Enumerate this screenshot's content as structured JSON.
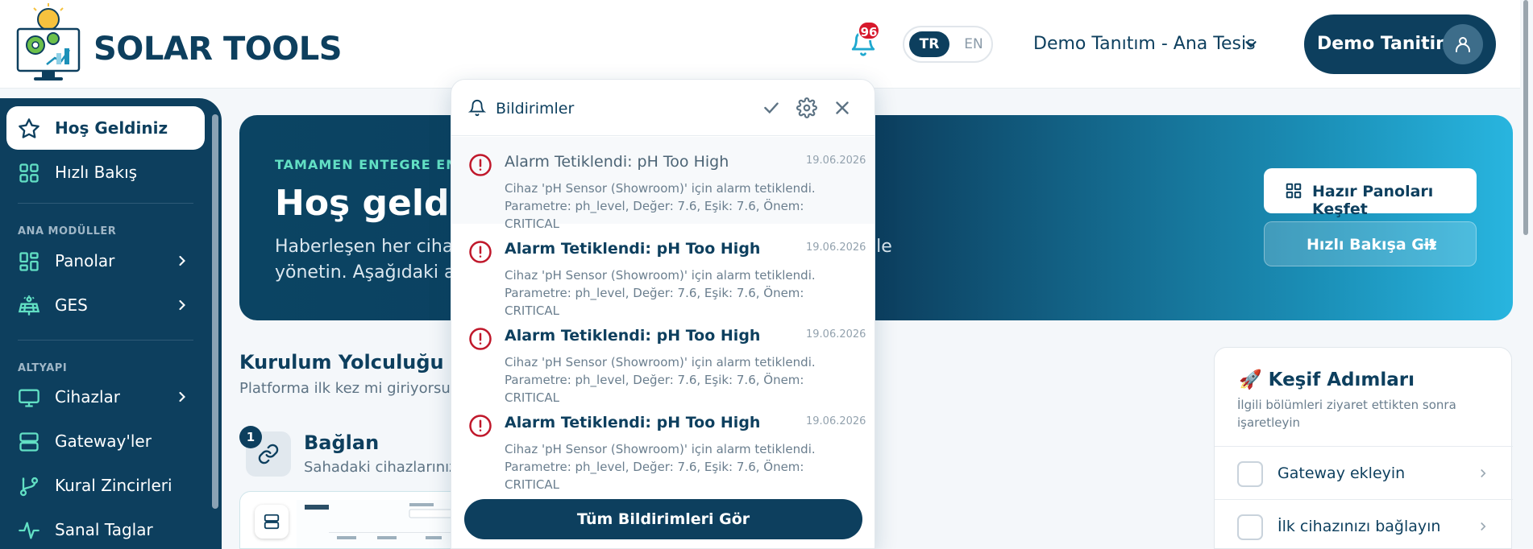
{
  "header": {
    "logo_text": "SOLAR TOOLS",
    "notification_count": "96",
    "lang_tr": "TR",
    "lang_en": "EN",
    "facility": "Demo Tanıtım - Ana Tesis",
    "user_name": "Demo Tanitim"
  },
  "sidebar": {
    "items_top": [
      {
        "label": "Hoş Geldiniz",
        "icon": "star-icon",
        "active": true
      },
      {
        "label": "Hızlı Bakış",
        "icon": "grid-icon"
      }
    ],
    "section_main": "ANA MODÜLLER",
    "items_main": [
      {
        "label": "Panolar",
        "icon": "dashboard-icon"
      },
      {
        "label": "GES",
        "icon": "solar-panel-icon"
      }
    ],
    "section_infra": "ALTYAPI",
    "items_infra": [
      {
        "label": "Cihazlar",
        "icon": "monitor-icon"
      },
      {
        "label": "Gateway'ler",
        "icon": "server-icon"
      },
      {
        "label": "Kural Zincirleri",
        "icon": "git-branch-icon"
      },
      {
        "label": "Sanal Taglar",
        "icon": "activity-icon"
      }
    ]
  },
  "hero": {
    "kicker": "TAMAMEN ENTEGRE ENE",
    "title": "Hoş geldiniz",
    "desc_line1_start": "Haberleşen her cihazı t",
    "desc_line1_end": "pay zekâ ile",
    "desc_line2": "yönetin. Aşağıdaki adım",
    "btn_explore": "Hazır Panoları Keşfet",
    "btn_quick": "Hızlı Bakışa Git"
  },
  "journey": {
    "title": "Kurulum Yolculuğu",
    "subtitle": "Platforma ilk kez mi giriyorsunuz",
    "step_number": "1",
    "step_title": "Bağlan",
    "step_desc": "Sahadaki cihazlarınızı"
  },
  "explore": {
    "title": "Keşif Adımları",
    "subtitle": "İlgili bölümleri ziyaret ettikten sonra işaretleyin",
    "items": [
      {
        "label": "Gateway ekleyin"
      },
      {
        "label": "İlk cihazınızı bağlayın"
      }
    ]
  },
  "notifications": {
    "title": "Bildirimler",
    "items": [
      {
        "title": "Alarm Tetiklendi: pH Too High",
        "date": "19.06.2026",
        "line1": "Cihaz 'pH Sensor (Showroom)' için alarm tetiklendi.",
        "line2": "Parametre: ph_level, Değer: 7.6, Eşik: 7.6, Önem: CRITICAL",
        "read": true
      },
      {
        "title": "Alarm Tetiklendi: pH Too High",
        "date": "19.06.2026",
        "line1": "Cihaz 'pH Sensor (Showroom)' için alarm tetiklendi.",
        "line2": "Parametre: ph_level, Değer: 7.6, Eşik: 7.6, Önem: CRITICAL",
        "read": false
      },
      {
        "title": "Alarm Tetiklendi: pH Too High",
        "date": "19.06.2026",
        "line1": "Cihaz 'pH Sensor (Showroom)' için alarm tetiklendi.",
        "line2": "Parametre: ph_level, Değer: 7.6, Eşik: 7.6, Önem: CRITICAL",
        "read": false
      },
      {
        "title": "Alarm Tetiklendi: pH Too High",
        "date": "19.06.2026",
        "line1": "Cihaz 'pH Sensor (Showroom)' için alarm tetiklendi.",
        "line2": "Parametre: ph_level, Değer: 7.6, Eşik: 7.6, Önem: CRITICAL",
        "read": false
      }
    ],
    "footer": "Tüm Bildirimleri Gör"
  },
  "colors": {
    "primary": "#0d3f5e",
    "accent_teal": "#62e0c4",
    "alert_red": "#d7192c"
  }
}
